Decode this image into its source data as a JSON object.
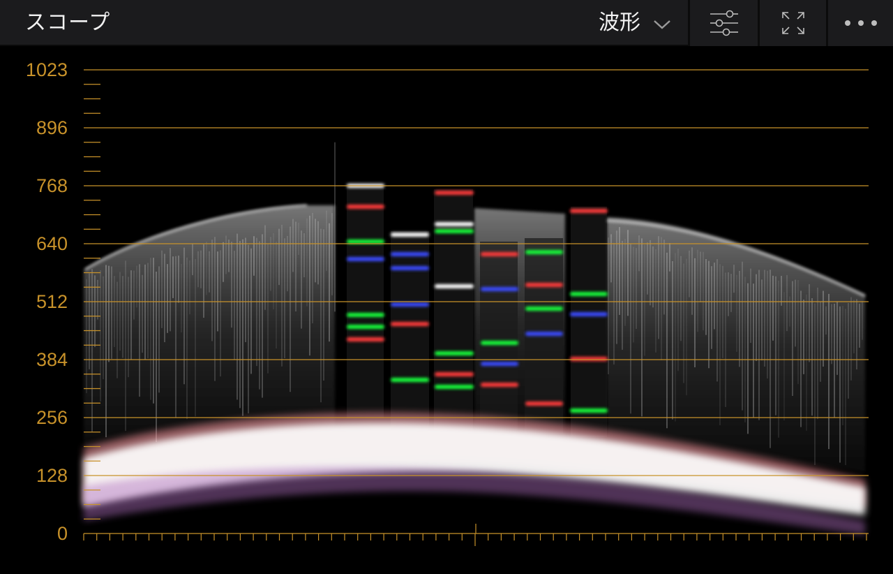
{
  "header": {
    "title": "スコープ",
    "mode_label": "波形"
  },
  "icons": {
    "mode_dropdown": "chevron-down-icon",
    "settings": "sliders-icon",
    "expand": "expand-icon",
    "more": "more-dots-icon"
  },
  "scope": {
    "y_ticks": [
      "1023",
      "896",
      "768",
      "640",
      "512",
      "384",
      "256",
      "128",
      "0"
    ],
    "colors": {
      "accent": "#c8922a",
      "background": "#000000",
      "header": "#1b1b1d"
    }
  }
}
